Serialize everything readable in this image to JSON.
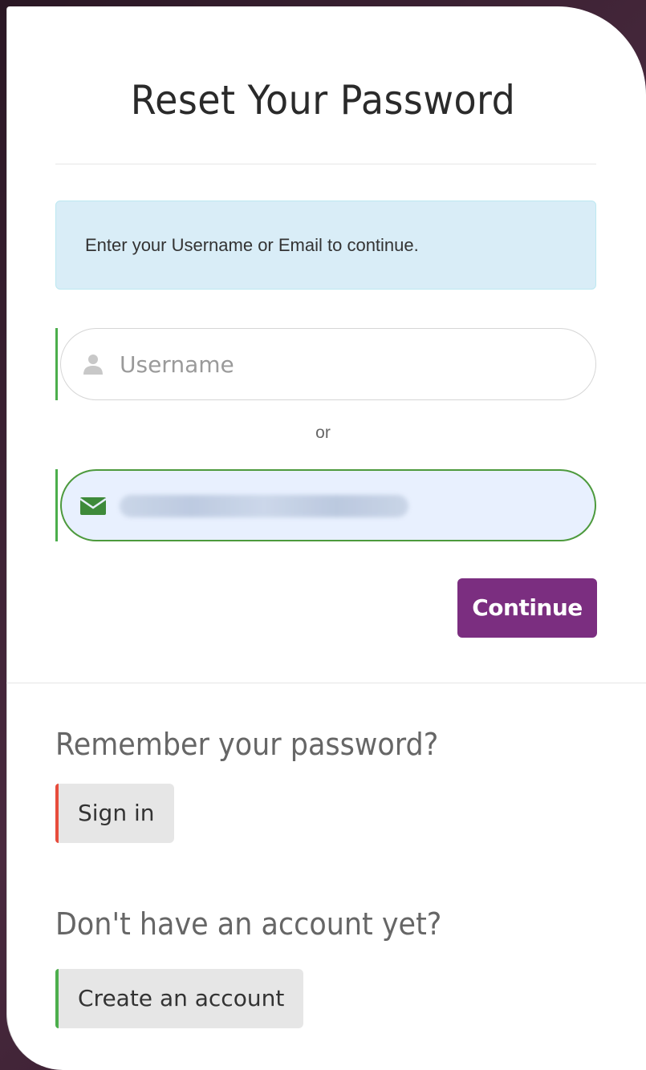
{
  "page": {
    "title": "Reset Your Password"
  },
  "info": {
    "message": "Enter your Username or Email to continue."
  },
  "username": {
    "placeholder": "Username",
    "icon": "user-icon"
  },
  "separator": {
    "text": "or"
  },
  "email": {
    "icon": "envelope-icon",
    "value_obscured": true
  },
  "actions": {
    "continue_label": "Continue"
  },
  "signin_section": {
    "question": "Remember your password?",
    "button_label": "Sign in",
    "accent_color": "#e74c3c"
  },
  "signup_section": {
    "question": "Don't have an account yet?",
    "button_label": "Create an account",
    "accent_color": "#4cae4c"
  },
  "colors": {
    "primary": "#7b2e80",
    "info_bg": "#d9edf7",
    "valid": "#4cae4c"
  }
}
